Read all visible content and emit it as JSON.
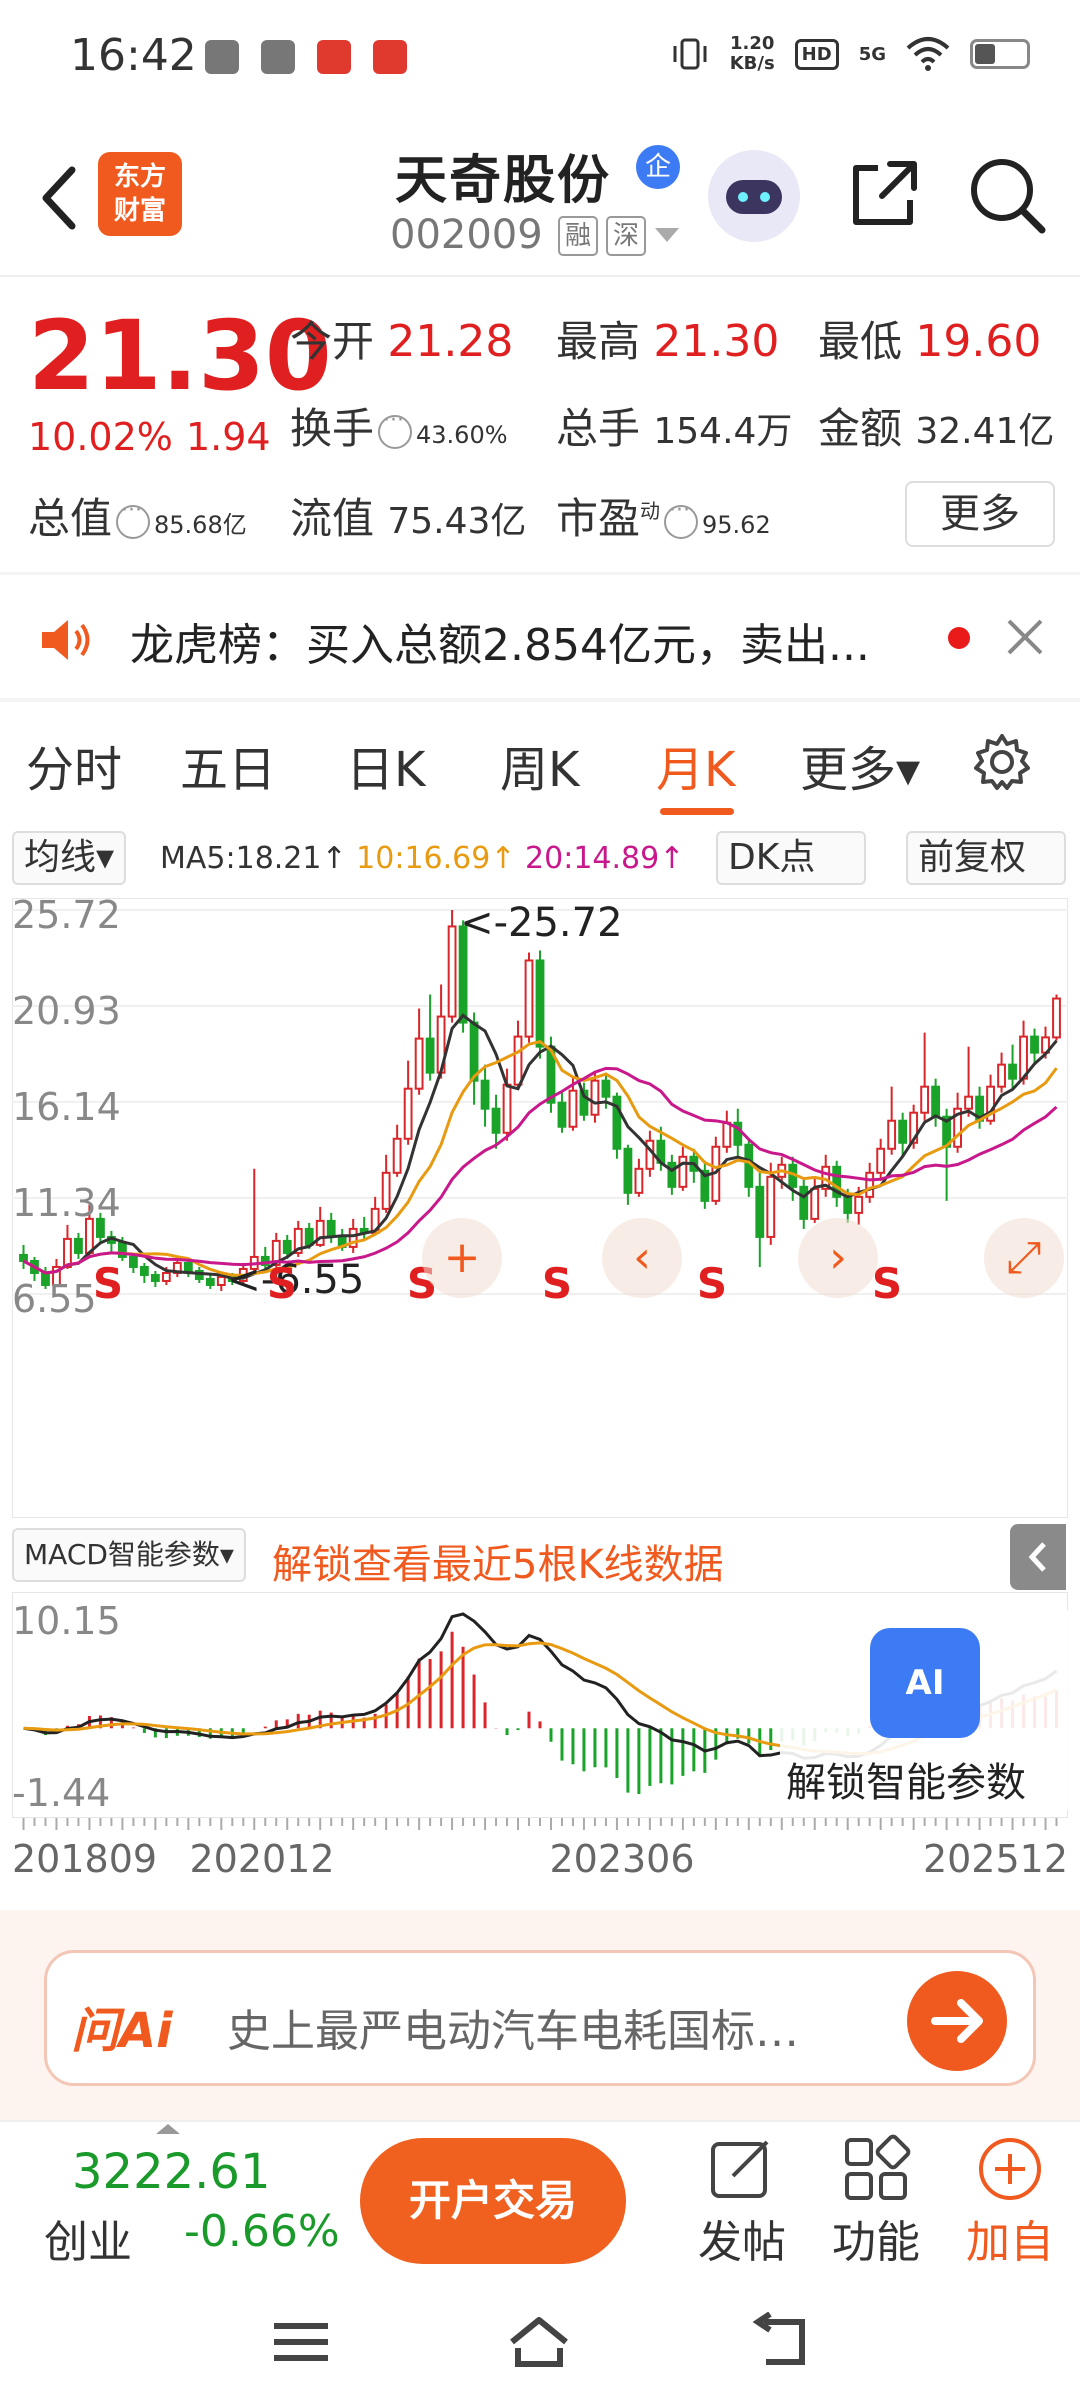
{
  "status": {
    "time": "16:42",
    "speed_top": "1.20",
    "speed_unit": "KB/s",
    "hd": "HD",
    "net": "5G"
  },
  "header": {
    "logo_line1": "东方",
    "logo_line2": "财富",
    "name": "天奇股份",
    "name_badge": "企",
    "code": "002009",
    "tag1": "融",
    "tag2": "深"
  },
  "quote": {
    "price": "21.30",
    "change_pct": "10.02%",
    "change_abs": "1.94",
    "open_label": "今开",
    "open_value": "21.28",
    "high_label": "最高",
    "high_value": "21.30",
    "low_label": "最低",
    "low_value": "19.60",
    "turnover_label": "换手",
    "turnover_value": "43.60%",
    "volume_label": "总手",
    "volume_value": "154.4万",
    "amount_label": "金额",
    "amount_value": "32.41亿",
    "mktcap_label": "总值",
    "mktcap_value": "85.68亿",
    "float_label": "流值",
    "float_value": "75.43亿",
    "pe_label": "市盈",
    "pe_sup": "动",
    "pe_value": "95.62",
    "more_label": "更多"
  },
  "news": {
    "text": "龙虎榜：买入总额2.854亿元，卖出..."
  },
  "tabs": [
    {
      "label": "分时"
    },
    {
      "label": "五日"
    },
    {
      "label": "日K"
    },
    {
      "label": "周K"
    },
    {
      "label": "月K",
      "active": true
    },
    {
      "label": "更多▾"
    }
  ],
  "indicators": {
    "ma_selector": "均线▾",
    "ma5": "MA5:18.21↑",
    "ma10": "10:16.69↑",
    "ma20": "20:14.89↑",
    "dk": "DK点",
    "adjust": "前复权",
    "ma5_color": "#333333",
    "ma10_color": "#e89a10",
    "ma20_color": "#c8188c"
  },
  "chart_data": {
    "type": "candlestick",
    "period": "monthly",
    "y_ticks": [
      "25.72",
      "20.93",
      "16.14",
      "11.34",
      "6.55"
    ],
    "ylim": [
      6.55,
      25.72
    ],
    "high_marker": "<-25.72",
    "low_marker": "<-6.55",
    "signal_labels": [
      "S",
      "S",
      "S",
      "S",
      "S",
      "S"
    ],
    "x_ticks": [
      "201809",
      "202012",
      "202306",
      "202512"
    ],
    "up_color": "#d8262a",
    "down_color": "#1aa329",
    "candles": [
      [
        8.5,
        8.2,
        9.0,
        7.8
      ],
      [
        8.2,
        7.6,
        8.4,
        7.2
      ],
      [
        7.6,
        7.0,
        7.9,
        6.8
      ],
      [
        7.0,
        7.9,
        8.3,
        6.9
      ],
      [
        7.9,
        9.3,
        10.0,
        7.8
      ],
      [
        9.3,
        8.6,
        9.6,
        8.3
      ],
      [
        8.6,
        10.3,
        11.0,
        8.4
      ],
      [
        10.3,
        9.4,
        10.6,
        9.1
      ],
      [
        9.4,
        9.1,
        9.7,
        8.6
      ],
      [
        9.1,
        8.4,
        9.4,
        8.2
      ],
      [
        8.4,
        7.9,
        8.6,
        7.6
      ],
      [
        7.9,
        7.5,
        8.1,
        7.1
      ],
      [
        7.5,
        7.2,
        7.7,
        6.9
      ],
      [
        7.2,
        7.6,
        7.9,
        7.0
      ],
      [
        7.6,
        8.1,
        8.4,
        7.4
      ],
      [
        8.1,
        7.7,
        8.3,
        7.4
      ],
      [
        7.7,
        7.3,
        7.9,
        7.1
      ],
      [
        7.3,
        7.0,
        7.6,
        6.8
      ],
      [
        7.0,
        7.4,
        7.6,
        6.7
      ],
      [
        7.4,
        7.2,
        7.6,
        7.0
      ],
      [
        7.2,
        7.8,
        8.1,
        7.0
      ],
      [
        7.8,
        8.4,
        12.8,
        7.6
      ],
      [
        8.4,
        8.0,
        8.9,
        7.7
      ],
      [
        8.0,
        9.2,
        9.6,
        7.8
      ],
      [
        9.2,
        8.6,
        9.5,
        8.3
      ],
      [
        8.6,
        9.8,
        10.2,
        8.4
      ],
      [
        9.8,
        9.0,
        10.1,
        8.8
      ],
      [
        9.0,
        10.2,
        10.9,
        8.9
      ],
      [
        10.2,
        9.4,
        10.6,
        9.1
      ],
      [
        9.4,
        8.9,
        9.8,
        8.7
      ],
      [
        8.9,
        9.8,
        10.3,
        8.6
      ],
      [
        9.8,
        9.6,
        10.4,
        9.3
      ],
      [
        9.6,
        10.8,
        11.4,
        9.5
      ],
      [
        10.8,
        12.6,
        13.5,
        10.6
      ],
      [
        12.6,
        14.3,
        15.0,
        12.4
      ],
      [
        14.3,
        16.8,
        18.2,
        14.0
      ],
      [
        16.8,
        19.3,
        20.8,
        16.5
      ],
      [
        19.3,
        17.6,
        21.5,
        17.2
      ],
      [
        17.6,
        20.4,
        22.0,
        17.3
      ],
      [
        20.4,
        24.9,
        25.72,
        20.1
      ],
      [
        24.9,
        20.1,
        25.2,
        19.6
      ],
      [
        20.1,
        17.2,
        20.6,
        16.0
      ],
      [
        17.2,
        15.8,
        18.0,
        14.9
      ],
      [
        15.8,
        14.6,
        16.5,
        13.8
      ],
      [
        14.6,
        17.0,
        17.8,
        14.2
      ],
      [
        17.0,
        19.4,
        20.2,
        16.8
      ],
      [
        19.4,
        23.2,
        23.6,
        19.1
      ],
      [
        23.2,
        18.9,
        23.7,
        18.3
      ],
      [
        18.9,
        16.1,
        19.4,
        15.6
      ],
      [
        16.1,
        14.9,
        16.7,
        14.6
      ],
      [
        14.9,
        16.7,
        17.4,
        14.7
      ],
      [
        16.7,
        15.5,
        17.1,
        15.2
      ],
      [
        15.5,
        17.2,
        17.6,
        15.1
      ],
      [
        17.2,
        16.4,
        17.6,
        15.8
      ],
      [
        16.4,
        13.8,
        16.6,
        13.3
      ],
      [
        13.8,
        11.6,
        14.0,
        11.0
      ],
      [
        11.6,
        12.8,
        13.3,
        11.4
      ],
      [
        12.8,
        14.2,
        14.7,
        12.4
      ],
      [
        14.2,
        13.1,
        14.9,
        12.7
      ],
      [
        13.1,
        11.9,
        13.5,
        11.5
      ],
      [
        11.9,
        13.4,
        13.9,
        11.7
      ],
      [
        13.4,
        12.7,
        13.8,
        12.1
      ],
      [
        12.7,
        11.2,
        13.2,
        10.8
      ],
      [
        11.2,
        13.9,
        14.4,
        11.0
      ],
      [
        13.9,
        15.1,
        15.7,
        13.6
      ],
      [
        15.1,
        14.0,
        15.8,
        13.4
      ],
      [
        14.0,
        11.9,
        14.3,
        11.4
      ],
      [
        11.9,
        9.4,
        12.6,
        7.9
      ],
      [
        9.4,
        12.4,
        13.1,
        9.0
      ],
      [
        12.4,
        13.0,
        13.4,
        11.8
      ],
      [
        13.0,
        11.9,
        13.4,
        11.2
      ],
      [
        11.9,
        10.3,
        12.3,
        9.8
      ],
      [
        10.3,
        11.8,
        12.3,
        10.1
      ],
      [
        11.8,
        12.9,
        13.5,
        11.4
      ],
      [
        12.9,
        11.4,
        13.2,
        10.9
      ],
      [
        11.4,
        10.6,
        11.8,
        10.1
      ],
      [
        10.6,
        11.4,
        11.9,
        10.0
      ],
      [
        11.4,
        12.6,
        13.1,
        11.1
      ],
      [
        12.6,
        13.8,
        14.3,
        12.2
      ],
      [
        13.8,
        15.2,
        16.9,
        13.5
      ],
      [
        15.2,
        14.1,
        15.6,
        13.4
      ],
      [
        14.1,
        15.6,
        16.0,
        13.8
      ],
      [
        15.6,
        16.9,
        19.6,
        15.2
      ],
      [
        16.9,
        15.4,
        17.3,
        14.9
      ],
      [
        15.4,
        13.9,
        15.8,
        11.2
      ],
      [
        13.9,
        15.8,
        16.6,
        13.6
      ],
      [
        15.8,
        16.4,
        18.9,
        15.4
      ],
      [
        16.4,
        15.2,
        16.9,
        14.8
      ],
      [
        15.2,
        16.9,
        17.5,
        15.0
      ],
      [
        16.9,
        18.0,
        18.6,
        16.6
      ],
      [
        18.0,
        17.3,
        19.0,
        16.8
      ],
      [
        17.3,
        19.4,
        20.2,
        17.0
      ],
      [
        19.4,
        18.6,
        19.8,
        18.1
      ],
      [
        18.6,
        19.36,
        19.9,
        18.3
      ],
      [
        19.36,
        21.3,
        21.5,
        19.2
      ]
    ],
    "macd_top_label": "10.15",
    "macd_bottom_label": "-1.44"
  },
  "macd": {
    "selector": "MACD智能参数▾",
    "promo": "解锁查看最近5根K线数据",
    "ai_label": "解锁智能参数",
    "ai_badge": "AI"
  },
  "ask": {
    "logo": "问Ai",
    "text": "史上最严电动汽车电耗国标…"
  },
  "bottom": {
    "index_value": "3222.61",
    "index_name": "创业",
    "index_change": "-0.66%",
    "trade_button": "开户交易",
    "post": "发帖",
    "functions": "功能",
    "add_fav": "加自"
  }
}
